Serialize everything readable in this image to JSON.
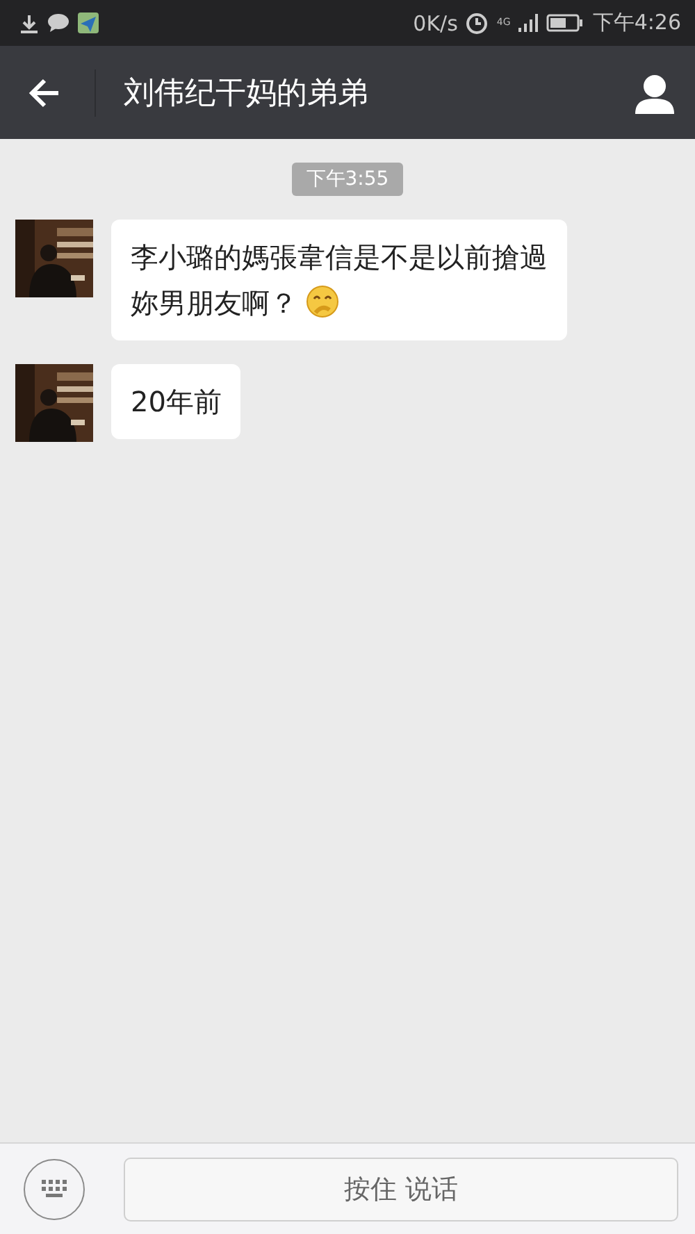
{
  "status_bar": {
    "speed": "0K/s",
    "network": "4G",
    "time": "下午4:26"
  },
  "header": {
    "title": "刘伟纪干妈的弟弟"
  },
  "chat": {
    "timestamp": "下午3:55",
    "messages": [
      {
        "text": "李小璐的媽張韋信是不是以前搶過妳男朋友啊？",
        "emoji": true
      },
      {
        "text": "20年前",
        "emoji": false
      }
    ]
  },
  "footer": {
    "voice_button": "按住 说话"
  }
}
